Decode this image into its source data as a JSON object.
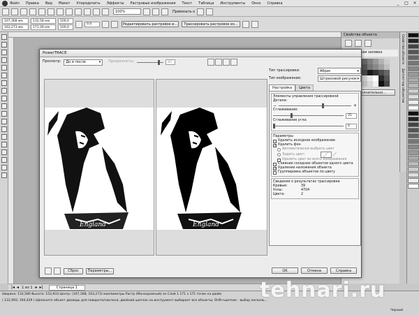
{
  "app": {
    "menu": [
      "Файл",
      "Правка",
      "Вид",
      "Макет",
      "Упорядочить",
      "Эффекты",
      "Растровые изображения",
      "Текст",
      "Таблица",
      "Инструменты",
      "Окно",
      "Справка"
    ],
    "window_controls": [
      "_",
      "□",
      "×"
    ],
    "zoom": "100%",
    "snap_label": "Привязать к",
    "edit_bitmap_btn": "Редактировать растровое и...",
    "trace_bitmap_btn": "Трассировать растровое из...",
    "coords": {
      "x": "107,368 мм",
      "y": "163,273 мм",
      "w": "132,58 мм",
      "h": "171,39 мм",
      "sx": "100,0",
      "sy": "100,0",
      "angle": "0,0"
    },
    "page_nav": {
      "counter": "1 из 1",
      "tab": "Страница 1"
    },
    "status_line1": "Ширина: 132,580 Высота: 152,933 Центр: (107,368; 163,273) миллиметры  Растр (Монохромный) on Слой 1 171 x 171 точек на дюйм",
    "status_line2": "( 122,993; 194,429 )   Щелкните объект дважды для поворота/наклона; двойной щелчок на инструмент выбирает все объекты; Shift+щелчок - выбор несколь...",
    "status_right": "Черный",
    "watermark": "tehnari.ru"
  },
  "dock": {
    "title": "Свойства объекта",
    "fill_label": "Однородная заливка",
    "more_btn": "Дополнительно...",
    "side_tabs": [
      "Свойства объекта",
      "Диспетчер объектов"
    ]
  },
  "colors": {
    "swatches": [
      "#111",
      "#222",
      "#444",
      "#555",
      "#666",
      "#777",
      "#888",
      "#999",
      "#aaa",
      "#bbb",
      "#ccc",
      "#ddd",
      "#eee",
      "#fff"
    ],
    "dock_grid": [
      "#1a1a1a",
      "#333",
      "#4d4d4d",
      "#666",
      "#808080",
      "#999",
      "#b3b3b3",
      "#ccc",
      "#e6e6e6",
      "#fff",
      "#2a2a2a",
      "#555",
      "#777",
      "#8a8a8a",
      "#a0a0a0",
      "#c0c0c0",
      "#d6d6d6",
      "#f0f0f0",
      "#111",
      "#444"
    ]
  },
  "dialog": {
    "title": "PowerTRACE",
    "preview_label": "Просмотр:",
    "preview_value": "До и после",
    "transparency_label": "Прозрачность:",
    "transparency_value": "80",
    "trace_type_label": "Тип трассировки:",
    "trace_type_value": "Абрис",
    "image_type_label": "Тип изображения:",
    "image_type_value": "Штриховой рисунок",
    "tabs": [
      "Настройка",
      "Цвета"
    ],
    "controls_header": "Элементы управления трассировкой",
    "detail_label": "Детали:",
    "smooth_label": "Сглаживание:",
    "smooth_value": "25",
    "corner_label": "Сглаживание угла:",
    "corner_value": "0",
    "params_header": "Параметры",
    "options": [
      {
        "label": "Удалить исходное изображение",
        "checked": false
      },
      {
        "label": "Удалить фон",
        "checked": true
      }
    ],
    "auto_color": "Автоматически выбрать цвет",
    "set_color": "Задать цвет:",
    "remove_all_color": "Удалить цвет из всего изображения",
    "options2": [
      {
        "label": "Слияние соседних объектов одного цвета",
        "checked": false
      },
      {
        "label": "Удаление наложения объекта",
        "checked": true
      },
      {
        "label": "Группировка объектов по цвету",
        "checked": false
      }
    ],
    "results_header": "Сведения о результатах трассировки",
    "results": [
      {
        "label": "Кривые:",
        "value": "39"
      },
      {
        "label": "Узлы:",
        "value": "4704"
      },
      {
        "label": "Цвета:",
        "value": "2"
      }
    ],
    "reset_btn": "Сброс",
    "params_btn": "Параметры...",
    "ok_btn": "OK",
    "cancel_btn": "Отмена",
    "help_btn": "Справка",
    "shirt_text": "England"
  }
}
